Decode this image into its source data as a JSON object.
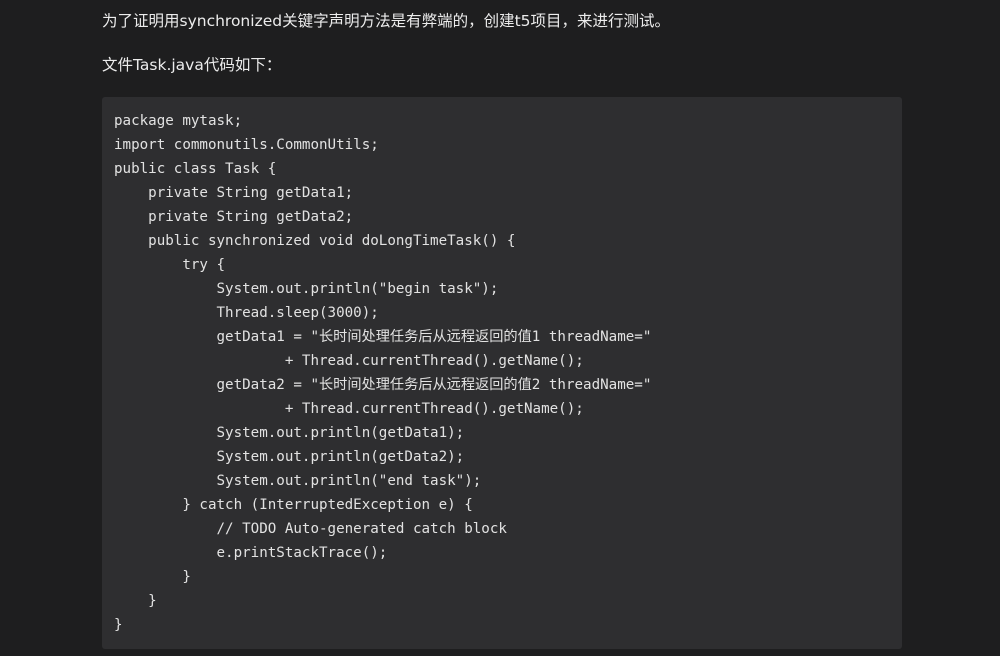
{
  "article": {
    "intro": "为了证明用synchronized关键字声明方法是有弊端的，创建t5项目，来进行测试。",
    "file_caption": "文件Task.java代码如下："
  },
  "code": {
    "lines": [
      "package mytask;",
      "import commonutils.CommonUtils;",
      "public class Task {",
      "    private String getData1;",
      "    private String getData2;",
      "    public synchronized void doLongTimeTask() {",
      "        try {",
      "            System.out.println(\"begin task\");",
      "            Thread.sleep(3000);",
      "            getData1 = \"长时间处理任务后从远程返回的值1 threadName=\"",
      "                    + Thread.currentThread().getName();",
      "            getData2 = \"长时间处理任务后从远程返回的值2 threadName=\"",
      "                    + Thread.currentThread().getName();",
      "            System.out.println(getData1);",
      "            System.out.println(getData2);",
      "            System.out.println(\"end task\");",
      "        } catch (InterruptedException e) {",
      "            // TODO Auto-generated catch block",
      "            e.printStackTrace();",
      "        }",
      "    }",
      "}"
    ]
  }
}
